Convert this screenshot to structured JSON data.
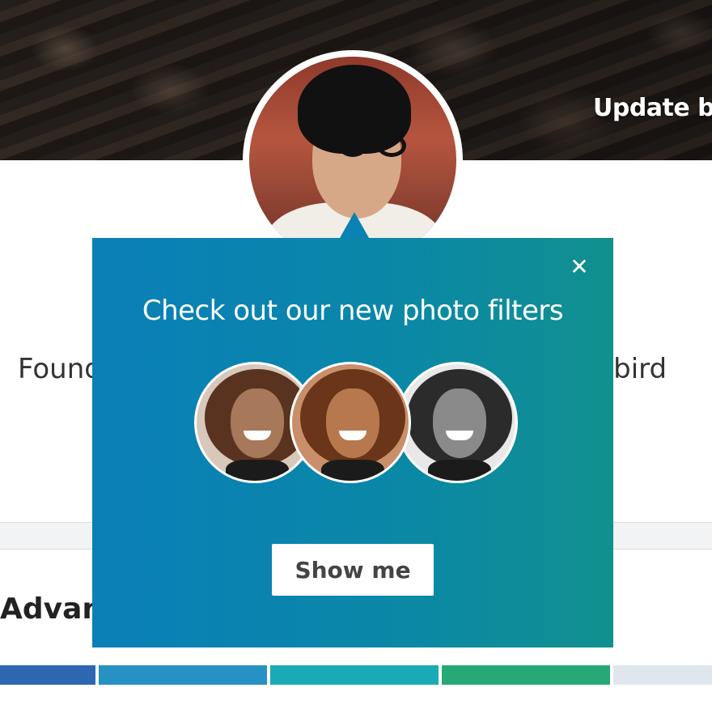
{
  "banner": {
    "update_label": "Update ba"
  },
  "profile": {
    "headline_left": "Found",
    "headline_right": "ybird"
  },
  "section": {
    "heading": "Advanc"
  },
  "strength_meter": {
    "colors": [
      "#2e67b1",
      "#2791c4",
      "#19aab5",
      "#29a877",
      "#dfe6ee"
    ]
  },
  "popup": {
    "title": "Check out our new photo filters",
    "close_glyph": "✕",
    "cta_label": "Show me",
    "filters": [
      "original",
      "warm",
      "black-and-white"
    ]
  }
}
